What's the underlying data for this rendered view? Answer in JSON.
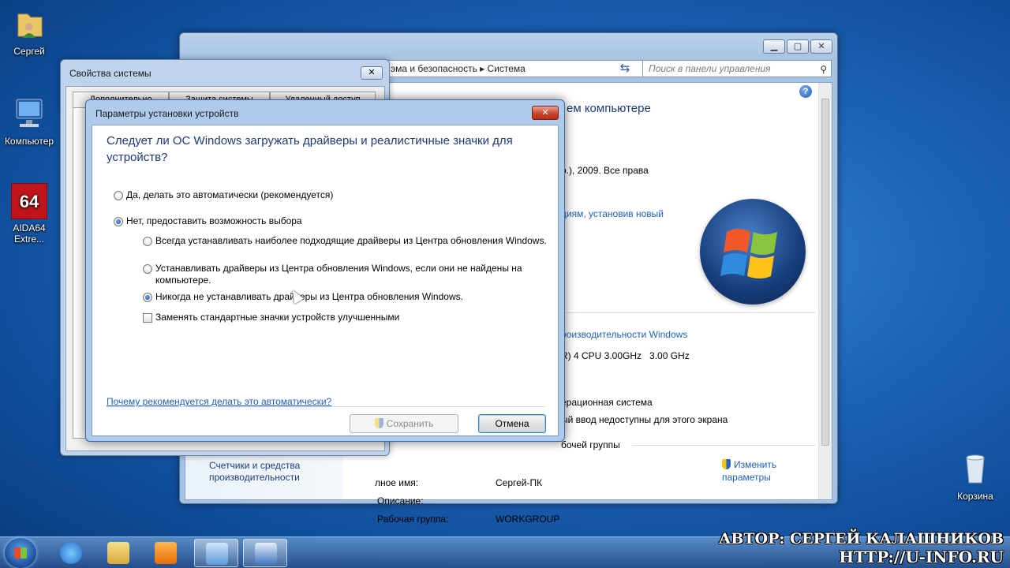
{
  "desktop": {
    "icons": [
      {
        "label": "Сергей",
        "icon": "user-folder-icon"
      },
      {
        "label": "Компьютер",
        "icon": "computer-icon"
      },
      {
        "label": "AIDA64 Extre...",
        "icon": "aida64-icon"
      },
      {
        "label": "Корзина",
        "icon": "recycle-bin-icon"
      }
    ]
  },
  "control_panel": {
    "breadcrumb": "эма и безопасность ▸ Система",
    "search_placeholder": "Поиск в панели управления",
    "heading_partial": "ем компьютере",
    "copyright_partial": "р.), 2009. Все права",
    "upgrade_link_partial": "циям, установив новый",
    "rating_link_partial": "роизводительности Windows",
    "processor_partial": "R) 4 CPU 3.00GHz   3.00 GHz",
    "os_type_partial": "ерационная система",
    "pen_partial": "ый ввод недоступны для этого экрана",
    "workgroup_section_partial": "бочей группы",
    "change_settings_label": "Изменить параметры",
    "left_link": "Счетчики и средства производительности",
    "rows": [
      {
        "label": "лное имя:",
        "value": "Сергей-ПК"
      },
      {
        "label": "Описание:",
        "value": ""
      },
      {
        "label": "Рабочая группа:",
        "value": "WORKGROUP"
      }
    ]
  },
  "system_properties": {
    "title": "Свойства системы",
    "tabs": [
      "Дополнительно",
      "Защита системы",
      "Удаленный доступ"
    ]
  },
  "dialog": {
    "title": "Параметры установки устройств",
    "question": "Следует ли ОС Windows загружать драйверы и реалистичные значки для устройств?",
    "option_auto": "Да, делать это автоматически (рекомендуется)",
    "option_manual": "Нет, предоставить возможность выбора",
    "sub_always": "Всегда устанавливать наиболее подходящие драйверы из Центра обновления Windows.",
    "sub_if_not_found": "Устанавливать драйверы из Центра обновления Windows, если они не найдены на компьютере.",
    "sub_never": "Никогда не устанавливать драйверы из Центра обновления Windows.",
    "replace_icons": "Заменять стандартные значки устройств улучшенными",
    "why_link": "Почему рекомендуется делать это автоматически?",
    "save_label": "Сохранить",
    "cancel_label": "Отмена",
    "selected": "manual",
    "selected_sub": "never",
    "replace_icons_checked": false
  },
  "watermark": {
    "author": "АВТОР:  СЕРГЕЙ  КАЛАШНИКОВ",
    "site": "HTTP://U-INFO.RU"
  },
  "colors": {
    "heading": "#1e3a78",
    "link": "#1e5fbf",
    "dialog_frame": "#aecbeb"
  }
}
